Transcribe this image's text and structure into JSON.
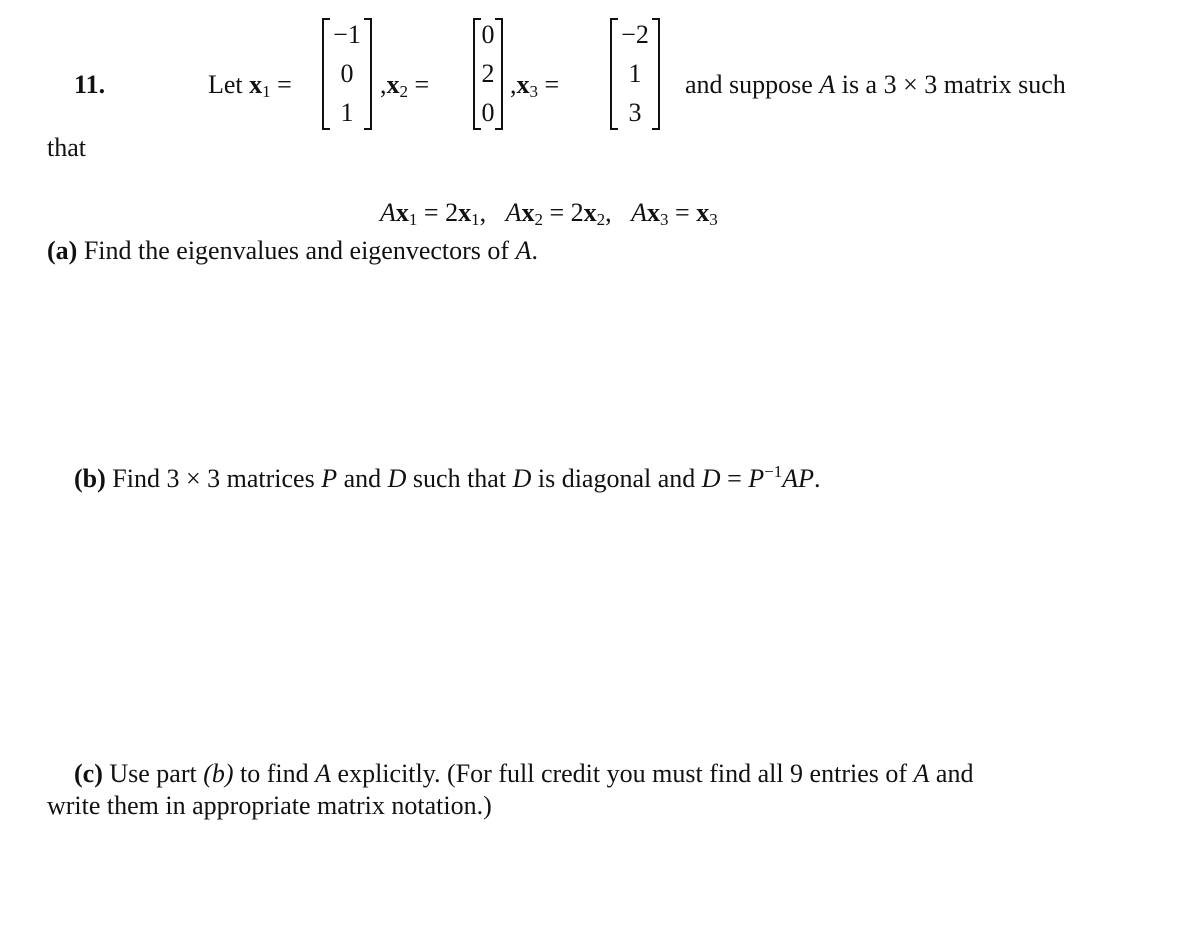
{
  "problem": {
    "number": "11.",
    "intro": {
      "let": "Let",
      "equals": "=",
      "comma": ",",
      "vectors": [
        {
          "name": "x",
          "subscript": "1",
          "entries": [
            "−1",
            "0",
            "1"
          ]
        },
        {
          "name": "x",
          "subscript": "2",
          "entries": [
            "0",
            "2",
            "0"
          ]
        },
        {
          "name": "x",
          "subscript": "3",
          "entries": [
            "−2",
            "1",
            "3"
          ]
        }
      ],
      "suffix_pre": "and suppose",
      "matrix_symbol": "A",
      "suffix_post": "is a 3 × 3 matrix such",
      "continuation": "that"
    },
    "equations": [
      {
        "lhs_matrix": "A",
        "lhs_vec": "x",
        "sub": "1",
        "rhs_coeff": "2",
        "rhs_vec": "x",
        "rhs_sub": "1",
        "sep": ","
      },
      {
        "lhs_matrix": "A",
        "lhs_vec": "x",
        "sub": "2",
        "rhs_coeff": "2",
        "rhs_vec": "x",
        "rhs_sub": "2",
        "sep": ","
      },
      {
        "lhs_matrix": "A",
        "lhs_vec": "x",
        "sub": "3",
        "rhs_coeff": "",
        "rhs_vec": "x",
        "rhs_sub": "3",
        "sep": ""
      }
    ],
    "parts": {
      "a": {
        "label": "(a)",
        "text": "Find the eigenvalues and eigenvectors of",
        "symbol": "A",
        "end": "."
      },
      "b": {
        "label": "(b)",
        "text1": "Find 3 × 3 matrices",
        "P": "P",
        "and": "and",
        "D": "D",
        "text2": "such that",
        "text3": "is diagonal and",
        "eq": "=",
        "P_inv": "P",
        "inv_exp": "−1",
        "AP": "AP",
        "end": "."
      },
      "c": {
        "label": "(c)",
        "text1": "Use part",
        "ref": "(b)",
        "text2": "to find",
        "A": "A",
        "text3": "explicitly. (For full credit you must find all 9 entries of",
        "text4": "and",
        "line2": "write them in appropriate matrix notation.)"
      }
    }
  }
}
